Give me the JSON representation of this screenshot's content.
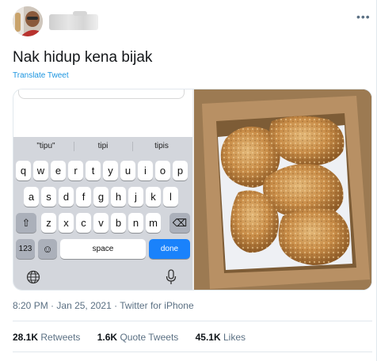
{
  "tweet": {
    "text": "Nak hidup kena bijak",
    "translate_label": "Translate Tweet",
    "more_label": "•••"
  },
  "phone": {
    "suggestions": [
      "\"tipu\"",
      "tipi",
      "tipis"
    ],
    "row1": [
      "q",
      "w",
      "e",
      "r",
      "t",
      "y",
      "u",
      "i",
      "o",
      "p"
    ],
    "row2": [
      "a",
      "s",
      "d",
      "f",
      "g",
      "h",
      "j",
      "k",
      "l"
    ],
    "row3": [
      "z",
      "x",
      "c",
      "v",
      "b",
      "n",
      "m"
    ],
    "num_label": "123",
    "space_label": "space",
    "done_label": "done",
    "shift_icon": "⇧",
    "backspace_icon": "⌫",
    "emoji_icon": "☺",
    "globe_icon": "🌐",
    "mic_icon": "🎤"
  },
  "meta": {
    "time": "8:20 PM",
    "date": "Jan 25, 2021",
    "source": "Twitter for iPhone",
    "separator": "·"
  },
  "stats": {
    "retweets_count": "28.1K",
    "retweets_label": "Retweets",
    "quotes_count": "1.6K",
    "quotes_label": "Quote Tweets",
    "likes_count": "45.1K",
    "likes_label": "Likes"
  },
  "colors": {
    "link": "#1b95e0",
    "secondary_text": "#5b7083",
    "done_key": "#1a82fb"
  }
}
